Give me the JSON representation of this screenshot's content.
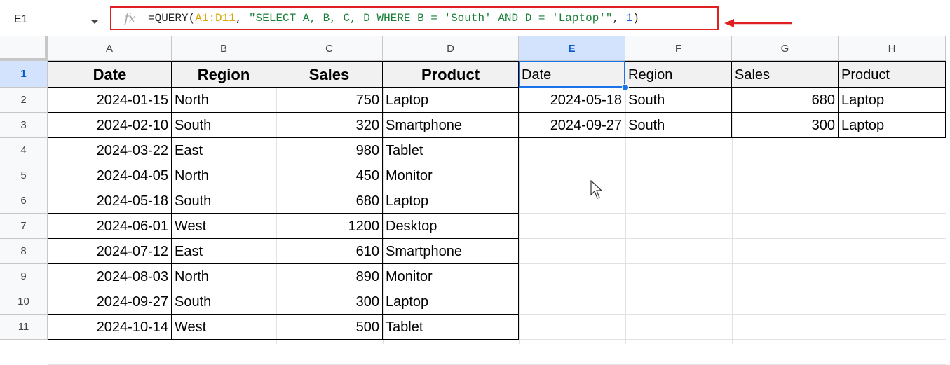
{
  "name_box": "E1",
  "formula": {
    "prefix": "=QUERY(",
    "range": "A1:D11",
    "sep1": ", ",
    "query": "\"SELECT A, B, C, D WHERE B = 'South' AND D = 'Laptop'\"",
    "sep2": ", ",
    "headers": "1",
    "suffix": ")"
  },
  "columns": [
    "A",
    "B",
    "C",
    "D",
    "E",
    "F",
    "G",
    "H"
  ],
  "rows": [
    "1",
    "2",
    "3",
    "4",
    "5",
    "6",
    "7",
    "8",
    "9",
    "10",
    "11"
  ],
  "selected_cell": "E1",
  "source_table": {
    "headers": [
      "Date",
      "Region",
      "Sales",
      "Product"
    ],
    "rows": [
      [
        "2024-01-15",
        "North",
        "750",
        "Laptop"
      ],
      [
        "2024-02-10",
        "South",
        "320",
        "Smartphone"
      ],
      [
        "2024-03-22",
        "East",
        "980",
        "Tablet"
      ],
      [
        "2024-04-05",
        "North",
        "450",
        "Monitor"
      ],
      [
        "2024-05-18",
        "South",
        "680",
        "Laptop"
      ],
      [
        "2024-06-01",
        "West",
        "1200",
        "Desktop"
      ],
      [
        "2024-07-12",
        "East",
        "610",
        "Smartphone"
      ],
      [
        "2024-08-03",
        "North",
        "890",
        "Monitor"
      ],
      [
        "2024-09-27",
        "South",
        "300",
        "Laptop"
      ],
      [
        "2024-10-14",
        "West",
        "500",
        "Tablet"
      ]
    ]
  },
  "query_result": {
    "headers": [
      "Date",
      "Region",
      "Sales",
      "Product"
    ],
    "rows": [
      [
        "2024-05-18",
        "South",
        "680",
        "Laptop"
      ],
      [
        "2024-09-27",
        "South",
        "300",
        "Laptop"
      ]
    ]
  },
  "colors": {
    "annotation": "#e02020",
    "selection": "#1a73e8",
    "header_fill": "#f1f1f1"
  }
}
